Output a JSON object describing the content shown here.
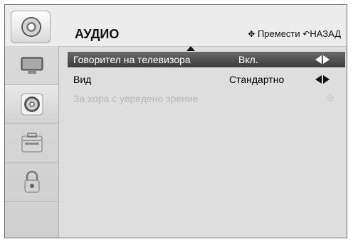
{
  "header": {
    "title": "АУДИО",
    "nav_hint": "Премести",
    "back_hint": "НАЗАД"
  },
  "sidebar": {
    "items": [
      {
        "name": "tv-screen"
      },
      {
        "name": "audio-speaker",
        "active": true
      },
      {
        "name": "tools-toolbox"
      },
      {
        "name": "lock"
      }
    ]
  },
  "menu": {
    "rows": [
      {
        "label": "Говорител на телевизора",
        "value": "Вкл.",
        "selected": true
      },
      {
        "label": "Вид",
        "value": "Стандартно"
      },
      {
        "label": "За хора с увредено зрение",
        "disabled": true
      }
    ]
  },
  "colors": {
    "selected_row": "#4f4f4f",
    "disabled_text": "#b8b8b8",
    "panel_bg": "#dedede"
  }
}
